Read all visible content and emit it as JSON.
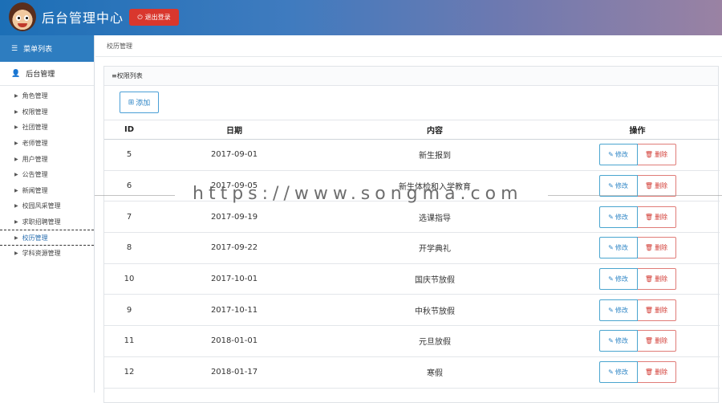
{
  "header": {
    "title": "后台管理中心",
    "logout_label": "退出登录"
  },
  "sidebar": {
    "menu_title": "菜单列表",
    "section_title": "后台管理",
    "items": [
      {
        "label": "角色管理"
      },
      {
        "label": "权限管理"
      },
      {
        "label": "社团管理"
      },
      {
        "label": "老师管理"
      },
      {
        "label": "用户管理"
      },
      {
        "label": "公告管理"
      },
      {
        "label": "新闻管理"
      },
      {
        "label": "校园风采管理"
      },
      {
        "label": "求职招聘管理"
      },
      {
        "label": "校历管理"
      },
      {
        "label": "学科资源管理"
      }
    ]
  },
  "breadcrumb": "校历管理",
  "panel": {
    "title": "≡权限列表",
    "add_label": "添加"
  },
  "table": {
    "headers": {
      "id": "ID",
      "date": "日期",
      "content": "内容",
      "ops": "操作"
    },
    "edit_label": "修改",
    "delete_label": "删除",
    "rows": [
      {
        "id": "5",
        "date": "2017-09-01",
        "content": "新生报到"
      },
      {
        "id": "6",
        "date": "2017-09-05",
        "content": "新生体检和入学教育"
      },
      {
        "id": "7",
        "date": "2017-09-19",
        "content": "选课指导"
      },
      {
        "id": "8",
        "date": "2017-09-22",
        "content": "开学典礼"
      },
      {
        "id": "10",
        "date": "2017-10-01",
        "content": "国庆节放假"
      },
      {
        "id": "9",
        "date": "2017-10-11",
        "content": "中秋节放假"
      },
      {
        "id": "11",
        "date": "2018-01-01",
        "content": "元旦放假"
      },
      {
        "id": "12",
        "date": "2018-01-17",
        "content": "寒假"
      }
    ]
  },
  "watermark": "https://www.songma.com"
}
